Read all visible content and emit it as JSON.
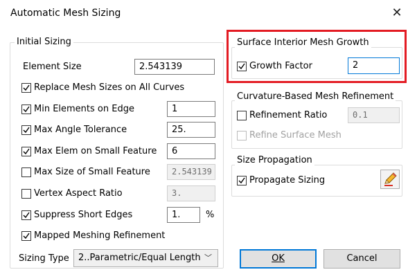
{
  "window": {
    "title": "Automatic Mesh Sizing",
    "close_glyph": "✕"
  },
  "initial_sizing": {
    "title": "Initial Sizing",
    "element_size_label": "Element Size",
    "element_size_value": "2.543139",
    "replace_mesh_sizes": {
      "label": "Replace Mesh Sizes on All Curves",
      "checked": true
    },
    "rows": [
      {
        "label": "Min Elements on Edge",
        "checked": true,
        "value": "1",
        "enabled": true
      },
      {
        "label": "Max Angle Tolerance",
        "checked": true,
        "value": "25.",
        "enabled": true
      },
      {
        "label": "Max Elem on Small Feature",
        "checked": true,
        "value": "6",
        "enabled": true
      },
      {
        "label": "Max Size of Small Feature",
        "checked": false,
        "value": "2.543139",
        "enabled": false
      },
      {
        "label": "Vertex Aspect Ratio",
        "checked": false,
        "value": "3.",
        "enabled": false
      }
    ],
    "suppress_short_edges": {
      "label": "Suppress Short Edges",
      "checked": true,
      "value": "1.",
      "unit": "%"
    },
    "mapped_meshing": {
      "label": "Mapped Meshing Refinement",
      "checked": true
    },
    "sizing_type_label": "Sizing Type",
    "sizing_type_value": "2..Parametric/Equal Length"
  },
  "surface_growth": {
    "title": "Surface Interior Mesh Growth",
    "growth_factor": {
      "label": "Growth Factor",
      "checked": true,
      "value": "2"
    }
  },
  "curvature": {
    "title": "Curvature-Based Mesh Refinement",
    "refinement_ratio": {
      "label": "Refinement Ratio",
      "checked": false,
      "value": "0.1"
    },
    "refine_surface_mesh": {
      "label": "Refine Surface Mesh",
      "checked": false,
      "enabled": false
    }
  },
  "size_propagation": {
    "title": "Size Propagation",
    "propagate_sizing": {
      "label": "Propagate Sizing",
      "checked": true
    },
    "edit_icon": "pencil-edit-icon"
  },
  "buttons": {
    "ok": "OK",
    "cancel": "Cancel"
  },
  "colors": {
    "highlight": "#e31b23",
    "focus": "#0078d7"
  }
}
